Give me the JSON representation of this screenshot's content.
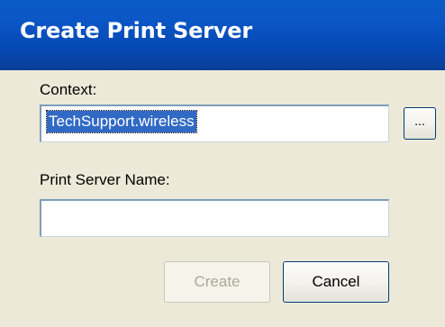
{
  "window": {
    "title": "Create Print Server"
  },
  "form": {
    "context_label": "Context:",
    "context_value": "TechSupport.wireless",
    "browse_label": "...",
    "server_name_label": "Print Server Name:",
    "server_name_value": ""
  },
  "buttons": {
    "create_label": "Create",
    "cancel_label": "Cancel"
  }
}
